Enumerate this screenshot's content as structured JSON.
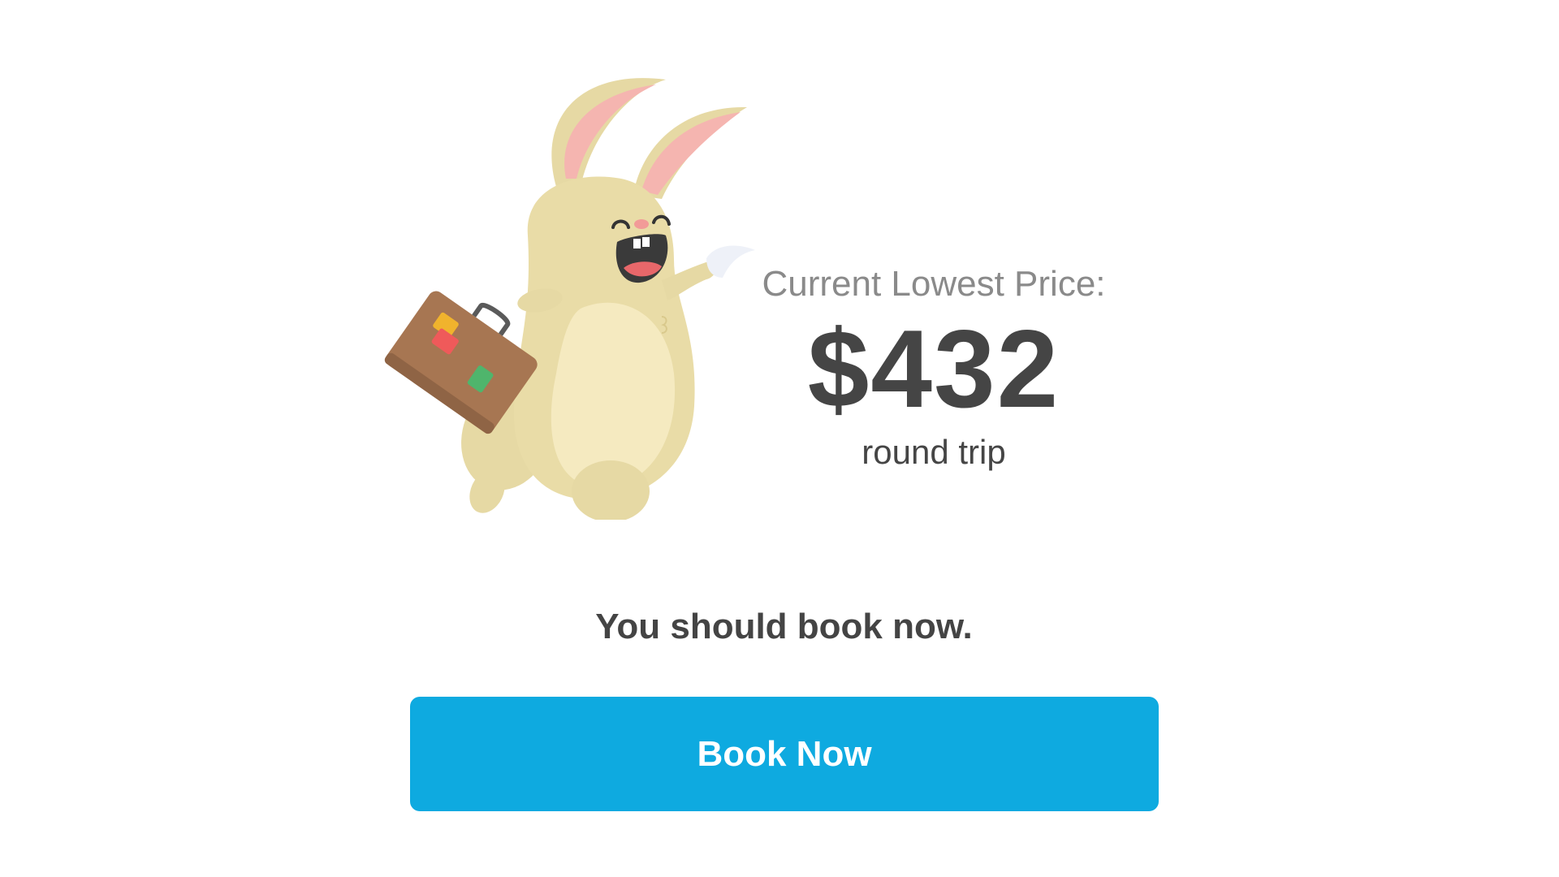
{
  "price_card": {
    "label": "Current Lowest Price:",
    "price": "$432",
    "trip_type": "round trip"
  },
  "recommendation": {
    "text": "You should book now."
  },
  "cta": {
    "label": "Book Now",
    "color": "#0eaae0"
  },
  "illustration": {
    "icon": "bunny-with-suitcase-illustration"
  }
}
